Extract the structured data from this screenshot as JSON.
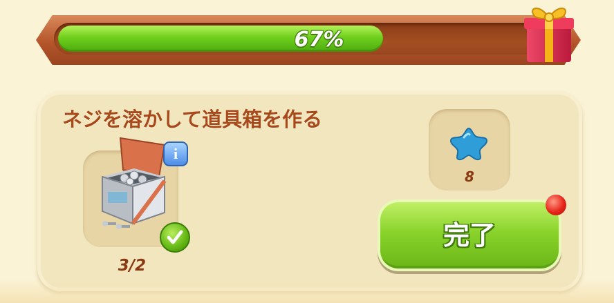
{
  "progress": {
    "value": 0.67,
    "label": "67%",
    "reward_icon": "gift-box-icon"
  },
  "task": {
    "title": "ネジを溶かして道具箱を作る",
    "item_icon": "toolbox-with-screws-icon",
    "info_icon": "info-icon",
    "complete_icon": "checkmark-icon",
    "item_count": "3/2",
    "reward_icon": "blue-star-gem-icon",
    "reward_amount": "8"
  },
  "actions": {
    "complete_label": "完了",
    "notification_icon": "red-notification-dot-icon"
  },
  "colors": {
    "background": "#fbf3d6",
    "progress_fill": "#6fcf1c",
    "title_text": "#a8491b",
    "button_green": "#8ad32c"
  }
}
